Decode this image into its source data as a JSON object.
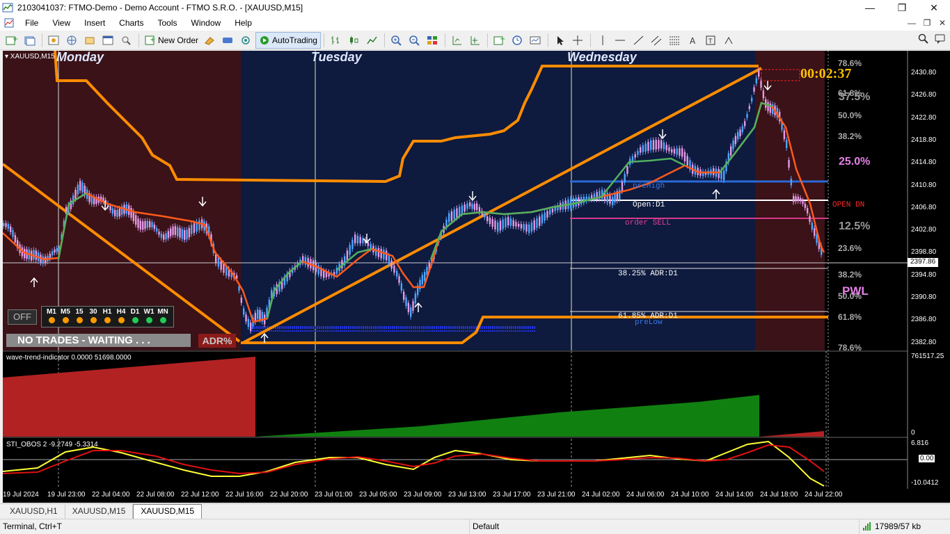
{
  "window": {
    "title": "2103041037: FTMO-Demo - Demo Account - FTMO S.R.O. - [XAUUSD,M15]",
    "minimize": "—",
    "maximize": "❐",
    "close": "✕"
  },
  "menu": {
    "items": [
      "File",
      "View",
      "Insert",
      "Charts",
      "Tools",
      "Window",
      "Help"
    ]
  },
  "toolbar": {
    "new_order_label": "New Order",
    "autotrading_label": "AutoTrading"
  },
  "chart": {
    "symbol_label": "▾ XAUUSD,M15",
    "days": [
      "Monday",
      "Tuesday",
      "Wednesday"
    ],
    "countdown": "00:02:37",
    "current_price": "2397.86",
    "price_ticks": [
      "2430.80",
      "2426.80",
      "2422.80",
      "2418.80",
      "2414.80",
      "2410.80",
      "2406.80",
      "2402.80",
      "2398.80",
      "2394.80",
      "2390.80",
      "2386.80",
      "2382.80"
    ],
    "fib_labels": {
      "top_786": "78.6%",
      "top_618": "61.8%",
      "top_50": "50.0%",
      "top_382": "38.2%",
      "p375": "37.5%",
      "p25": "25.0%",
      "p125": "12.5%",
      "mid_236": "23.6%",
      "low_382": "38.2%",
      "low_50": "50.0%",
      "low_618": "61.8%",
      "low_786": "78.6%"
    },
    "level_labels": {
      "pre_high": "preHigh",
      "open_d1": "Open:D1",
      "order_sell": "order SELL",
      "adr_382": "38.25% ADR:D1",
      "adr_618": "61.85% ADR:D1",
      "pre_low": "preLow",
      "open_dn": "OPEN DN",
      "pwl": "PWL"
    },
    "panel": {
      "off_label": "OFF",
      "timeframes": [
        "M1",
        "M5",
        "15",
        "30",
        "H1",
        "H4",
        "D1",
        "W1",
        "MN"
      ],
      "status": "NO TRADES - WAITING . . .",
      "adr_badge": "ADR%"
    },
    "wave_indicator": {
      "label": "wave-trend-indicator 0.0000 51698.0000",
      "top_value": "761517.25",
      "bottom_value": "0"
    },
    "obos_indicator": {
      "label": "STI_OBOS 2 -9.2749 -5.3314",
      "top_value": "6.816",
      "mid_value": "0.00",
      "bottom_value": "-10.0412"
    },
    "time_ticks": [
      "19 Jul 2024",
      "19 Jul 23:00",
      "22 Jul 04:00",
      "22 Jul 08:00",
      "22 Jul 12:00",
      "22 Jul 16:00",
      "22 Jul 20:00",
      "23 Jul 01:00",
      "23 Jul 05:00",
      "23 Jul 09:00",
      "23 Jul 13:00",
      "23 Jul 17:00",
      "23 Jul 21:00",
      "24 Jul 02:00",
      "24 Jul 06:00",
      "24 Jul 10:00",
      "24 Jul 14:00",
      "24 Jul 18:00",
      "24 Jul 22:00"
    ],
    "colors": {
      "monday_bg": "#3a1218",
      "tuesday_bg": "#0e1a3e",
      "orange": "#ff8c00",
      "bull": "#4da6ff",
      "bear": "#e59be6"
    }
  },
  "tabs": [
    "XAUUSD,H1",
    "XAUUSD,M15",
    "XAUUSD,M15"
  ],
  "status": {
    "help": "Terminal, Ctrl+T",
    "profile": "Default",
    "traffic": "17989/57 kb"
  }
}
